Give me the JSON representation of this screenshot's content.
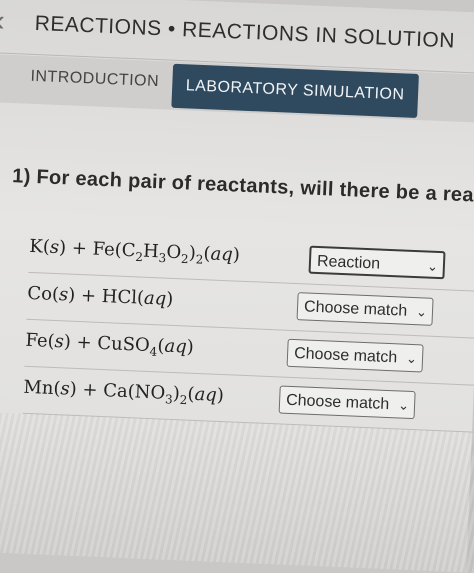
{
  "header": {
    "title": "REACTIONS • REACTIONS IN SOLUTION"
  },
  "tabs": [
    {
      "label": "INTRODUCTION"
    },
    {
      "label": "LABORATORY SIMULATION"
    }
  ],
  "question": "1) For each pair of reactants, will there be a rea",
  "rows": [
    {
      "select_value": "Reaction"
    },
    {
      "select_value": "Choose match"
    },
    {
      "select_value": "Choose match"
    },
    {
      "select_value": "Choose match"
    }
  ],
  "icons": {
    "back": "chevron-left-icon",
    "dropdown": "chevron-down-icon"
  },
  "colors": {
    "active_tab": "#2f4a5f"
  }
}
